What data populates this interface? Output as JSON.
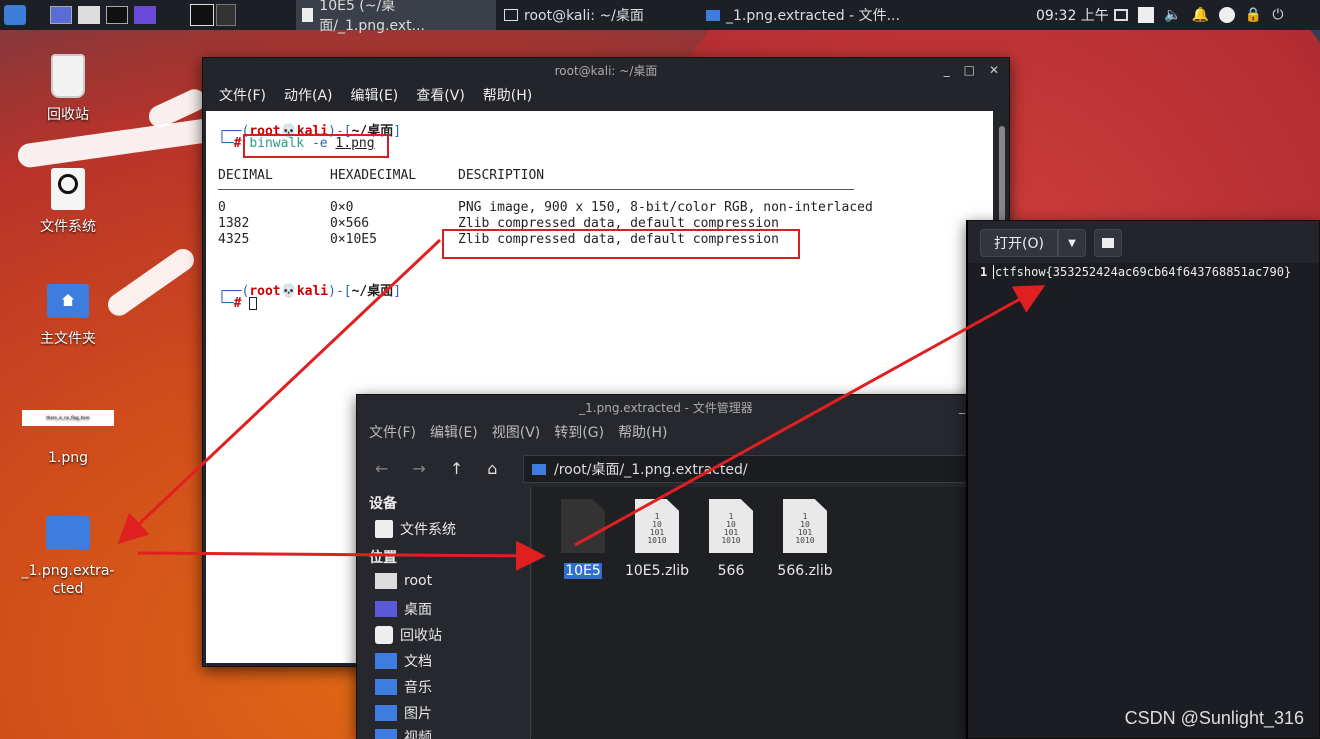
{
  "panel": {
    "tasks": [
      {
        "label": "10E5 (~/桌面/_1.png.ext...",
        "active": true
      },
      {
        "label": "root@kali: ~/桌面",
        "active": false
      },
      {
        "label": "_1.png.extracted - 文件...",
        "active": false
      }
    ],
    "clock": "09:32 上午"
  },
  "desktop": {
    "icons": [
      {
        "label": "回收站",
        "icon": "trash-icon"
      },
      {
        "label": "文件系统",
        "icon": "drive-icon"
      },
      {
        "label": "主文件夹",
        "icon": "home-folder-icon"
      },
      {
        "label": "1.png",
        "icon": "image-thumbnail",
        "thumb_text": "there_is_no_flag_here"
      },
      {
        "label": "_1.png.extra-\ncted",
        "icon": "folder-icon"
      }
    ]
  },
  "terminal": {
    "title": "root@kali: ~/桌面",
    "menu": [
      "文件(F)",
      "动作(A)",
      "编辑(E)",
      "查看(V)",
      "帮助(H)"
    ],
    "prompt_user": "root",
    "prompt_host": "kali",
    "prompt_dir": "~/桌面",
    "prompt_hash": "#",
    "command_bin": "binwalk",
    "command_flag": "-e",
    "command_arg": "1.png",
    "headers": [
      "DECIMAL",
      "HEXADECIMAL",
      "DESCRIPTION"
    ],
    "rows": [
      [
        "0",
        "0×0",
        "PNG image, 900 x 150, 8-bit/color RGB, non-interlaced"
      ],
      [
        "1382",
        "0×566",
        "Zlib compressed data, default compression"
      ],
      [
        "4325",
        "0×10E5",
        "Zlib compressed data, default compression"
      ]
    ]
  },
  "file_manager": {
    "title": "_1.png.extracted - 文件管理器",
    "menu": [
      "文件(F)",
      "编辑(E)",
      "视图(V)",
      "转到(G)",
      "帮助(H)"
    ],
    "path": "/root/桌面/_1.png.extracted/",
    "side_devices_header": "设备",
    "side_places_header": "位置",
    "side_devices": [
      {
        "label": "文件系统",
        "icon": "drive-icon"
      }
    ],
    "side_places": [
      {
        "label": "root",
        "icon": "home-icon"
      },
      {
        "label": "桌面",
        "icon": "desktop-folder-icon"
      },
      {
        "label": "回收站",
        "icon": "trash-icon"
      },
      {
        "label": "文档",
        "icon": "documents-folder-icon"
      },
      {
        "label": "音乐",
        "icon": "music-folder-icon"
      },
      {
        "label": "图片",
        "icon": "pictures-folder-icon"
      },
      {
        "label": "视频",
        "icon": "videos-folder-icon"
      }
    ],
    "files": [
      {
        "name": "10E5",
        "selected": true
      },
      {
        "name": "10E5.zlib",
        "selected": false
      },
      {
        "name": "566",
        "selected": false
      },
      {
        "name": "566.zlib",
        "selected": false
      }
    ]
  },
  "editor": {
    "open_label": "打开(O)",
    "line_number": "1",
    "content": "ctfshow{353252424ac69cb64f643768851ac790}"
  },
  "watermark": "CSDN @Sunlight_316"
}
